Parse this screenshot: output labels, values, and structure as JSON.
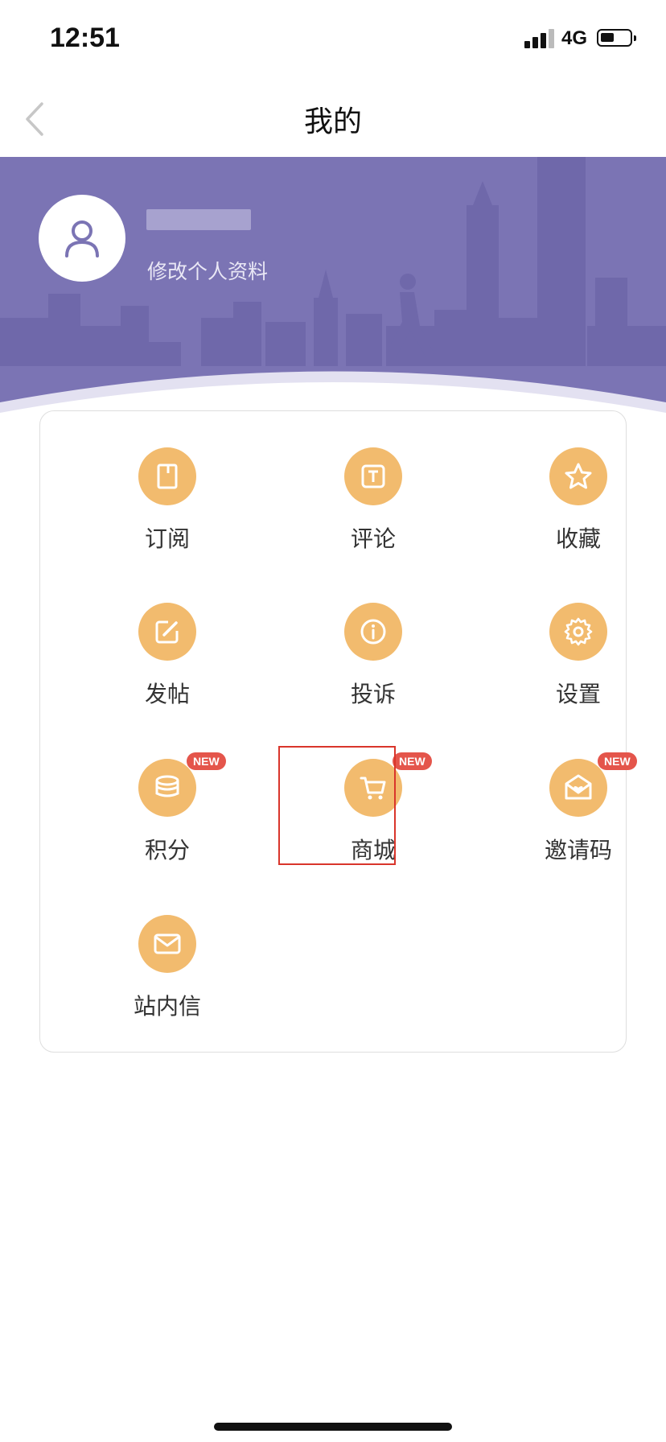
{
  "status_bar": {
    "time": "12:51",
    "network": "4G"
  },
  "nav": {
    "title": "我的"
  },
  "profile": {
    "edit_label": "修改个人资料"
  },
  "menu": {
    "items": [
      {
        "label": "订阅",
        "icon": "book-icon"
      },
      {
        "label": "评论",
        "icon": "text-box-icon"
      },
      {
        "label": "收藏",
        "icon": "star-icon"
      },
      {
        "label": "发帖",
        "icon": "edit-icon"
      },
      {
        "label": "投诉",
        "icon": "info-icon"
      },
      {
        "label": "设置",
        "icon": "gear-icon"
      },
      {
        "label": "积分",
        "icon": "coins-icon",
        "badge": "NEW"
      },
      {
        "label": "商城",
        "icon": "cart-icon",
        "badge": "NEW"
      },
      {
        "label": "邀请码",
        "icon": "envelope-heart-icon",
        "badge": "NEW"
      },
      {
        "label": "站内信",
        "icon": "mail-icon"
      }
    ]
  },
  "colors": {
    "banner": "#7b74b4",
    "icon_bg": "#f2bb6e",
    "badge": "#e4554b",
    "highlight": "#d9352b"
  }
}
